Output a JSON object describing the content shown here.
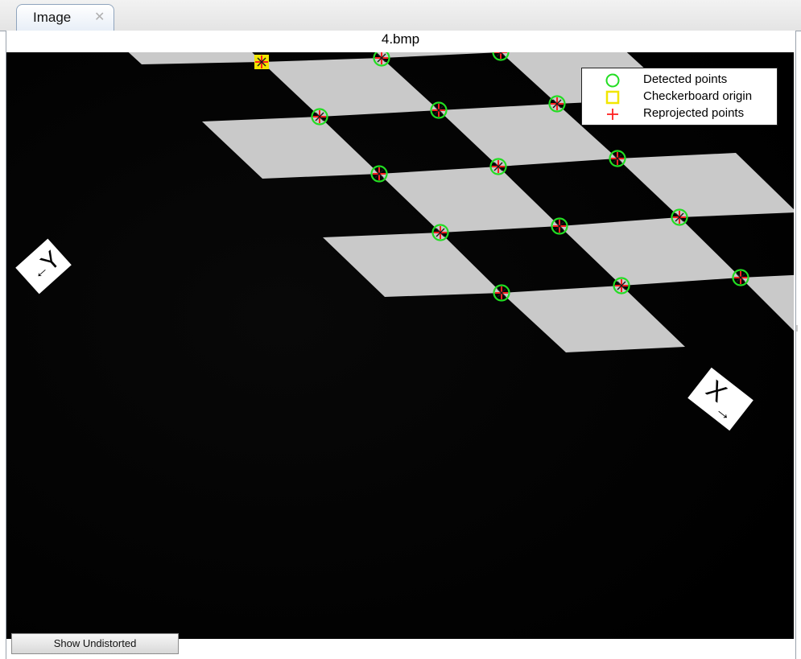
{
  "tab": {
    "label": "Image",
    "close_glyph": "✕",
    "close_icon": "close-icon"
  },
  "figure": {
    "filename": "4.bmp"
  },
  "legend": {
    "detected": {
      "label": "Detected points",
      "color": "#22dd22",
      "icon": "circle-marker-icon"
    },
    "origin": {
      "label": "Checkerboard origin",
      "color": "#f2e600",
      "icon": "square-marker-icon"
    },
    "reprojected": {
      "label": "Reprojected points",
      "color": "#ff2020",
      "icon": "plus-marker-icon"
    }
  },
  "axes_labels": {
    "x": "X",
    "y": "Y",
    "x_arrow": "→",
    "y_arrow": "←"
  },
  "button": {
    "label": "Show Undistorted"
  }
}
